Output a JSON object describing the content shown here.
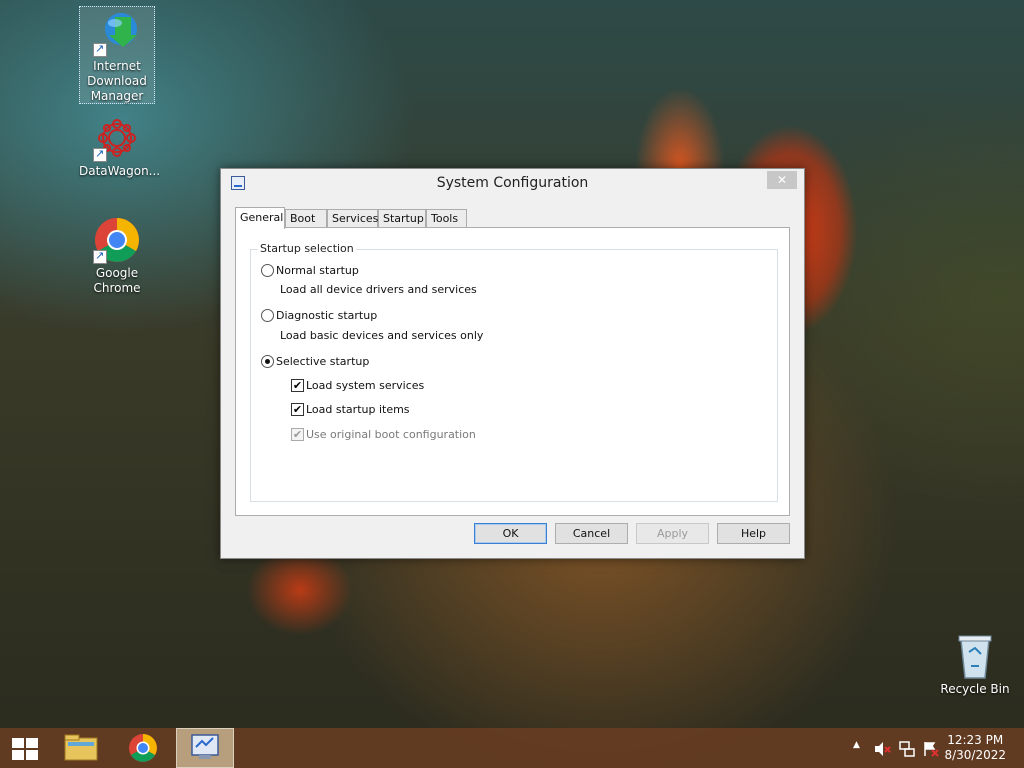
{
  "desktop": {
    "icons": [
      {
        "label": "Internet Download Manager"
      },
      {
        "label": "DataWagon..."
      },
      {
        "label": "Google Chrome"
      },
      {
        "label": "Recycle Bin"
      }
    ]
  },
  "dialog": {
    "title": "System Configuration",
    "close_label": "✕",
    "tabs": [
      {
        "label": "General",
        "active": true
      },
      {
        "label": "Boot"
      },
      {
        "label": "Services"
      },
      {
        "label": "Startup"
      },
      {
        "label": "Tools"
      }
    ],
    "group_label": "Startup selection",
    "options": {
      "normal": {
        "label": "Normal startup",
        "desc": "Load all device drivers and services",
        "selected": false
      },
      "diagnostic": {
        "label": "Diagnostic startup",
        "desc": "Load basic devices and services only",
        "selected": false
      },
      "selective": {
        "label": "Selective startup",
        "selected": true
      }
    },
    "checks": {
      "system_services": {
        "label": "Load system services",
        "checked": true
      },
      "startup_items": {
        "label": "Load startup items",
        "checked": true
      },
      "original_boot": {
        "label": "Use original boot configuration",
        "checked": true,
        "disabled": true
      }
    },
    "buttons": {
      "ok": "OK",
      "cancel": "Cancel",
      "apply": "Apply",
      "help": "Help"
    }
  },
  "taskbar": {
    "clock_time": "12:23 PM",
    "clock_date": "8/30/2022"
  },
  "colors": {
    "taskbar": "#693c23",
    "dialog_bg": "#f0f0f0",
    "default_button_border": "#3c7fd0"
  }
}
